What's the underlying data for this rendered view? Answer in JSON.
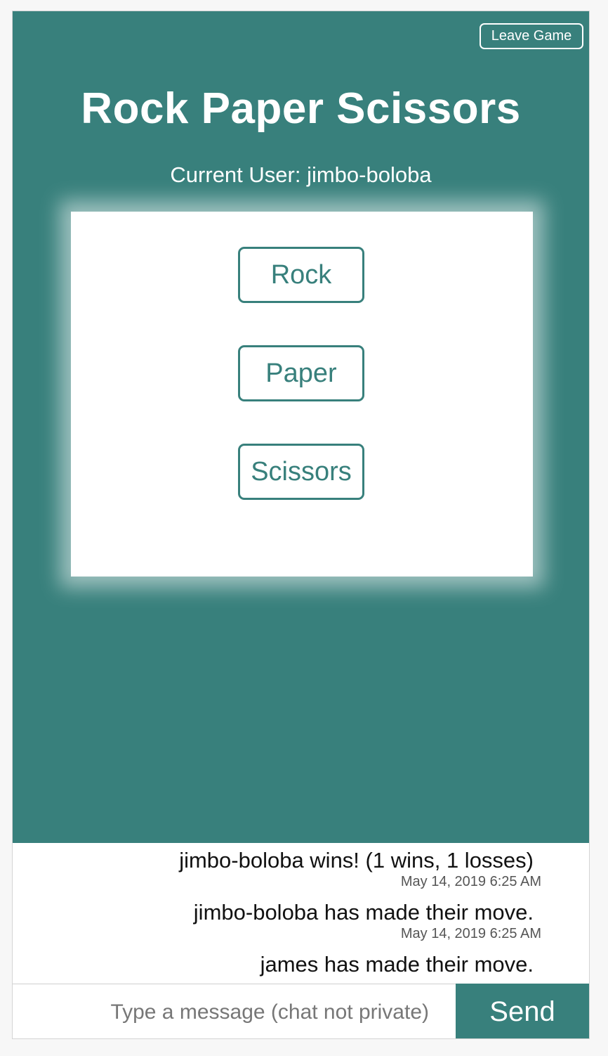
{
  "header": {
    "leave_label": "Leave Game",
    "title": "Rock Paper Scissors",
    "current_user": "Current User: jimbo-boloba"
  },
  "moves": {
    "rock": "Rock",
    "paper": "Paper",
    "scissors": "Scissors"
  },
  "chat": {
    "messages": [
      {
        "text": "jimbo-boloba wins! (1 wins, 1 losses)",
        "time": "May 14, 2019 6:25 AM"
      },
      {
        "text": "jimbo-boloba has made their move.",
        "time": "May 14, 2019 6:25 AM"
      },
      {
        "text": "james has made their move."
      }
    ],
    "input_placeholder": "Type a message (chat not private)",
    "input_value": "",
    "send_label": "Send"
  },
  "colors": {
    "accent": "#38807c",
    "card": "#ffffff",
    "text_light": "#ffffff"
  }
}
